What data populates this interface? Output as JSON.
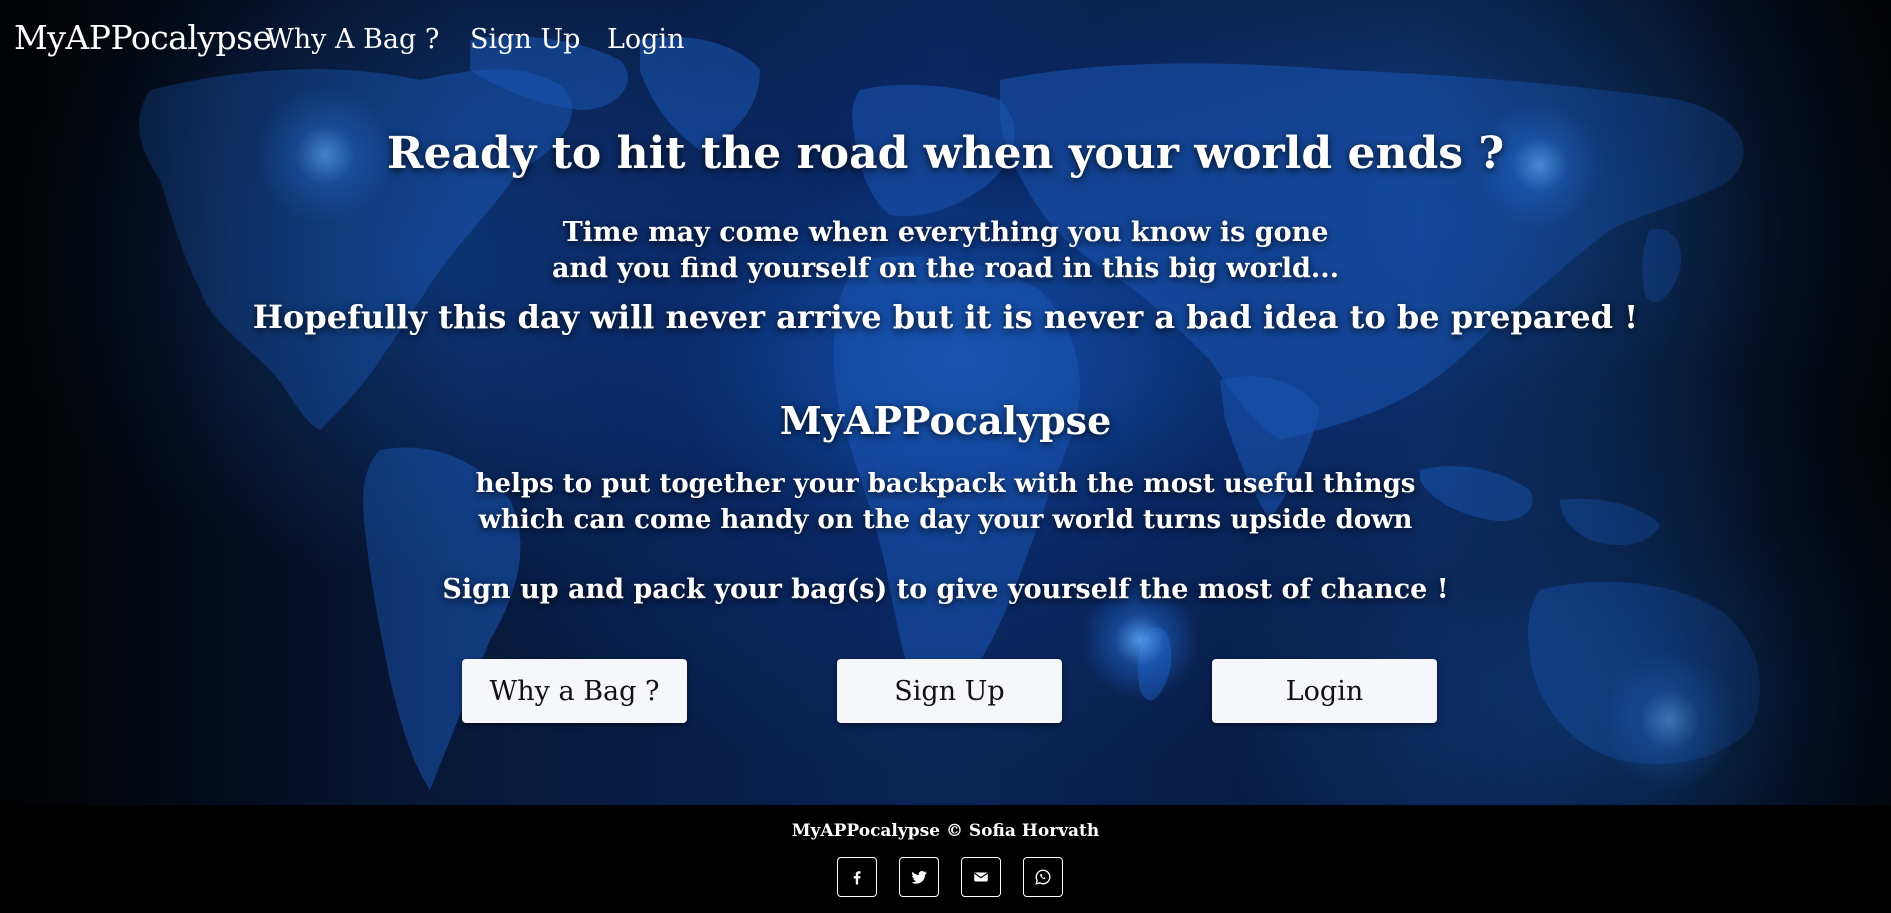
{
  "navbar": {
    "brand": "MyAPPocalypse",
    "links": [
      {
        "label": "Why A Bag ?"
      },
      {
        "label": "Sign Up"
      },
      {
        "label": "Login"
      }
    ]
  },
  "hero": {
    "headline": "Ready to hit the road when your world ends ?",
    "intro_lines": [
      "Time may come when everything you know is gone",
      "and you find yourself on the road in this big world..."
    ],
    "hope": "Hopefully this day will never arrive but it is never a bad idea to be prepared !",
    "app_name": "MyAPPocalypse",
    "description_lines": [
      "helps to put together your backpack with the most useful things",
      "which can come handy on the day your world turns upside down"
    ],
    "call_to_action": "Sign up and pack your bag(s) to give yourself the most of chance !"
  },
  "buttons": {
    "why_bag": "Why a Bag ?",
    "sign_up": "Sign Up",
    "login": "Login"
  },
  "footer": {
    "copyright": "MyAPPocalypse © Sofia Horvath",
    "social_icons": [
      "facebook-icon",
      "twitter-icon",
      "email-icon",
      "whatsapp-icon"
    ]
  },
  "colors": {
    "background": "#05080f",
    "map_blue": "#1f5fc0",
    "button_bg": "#f5f7fa",
    "footer_bg": "#000000"
  }
}
